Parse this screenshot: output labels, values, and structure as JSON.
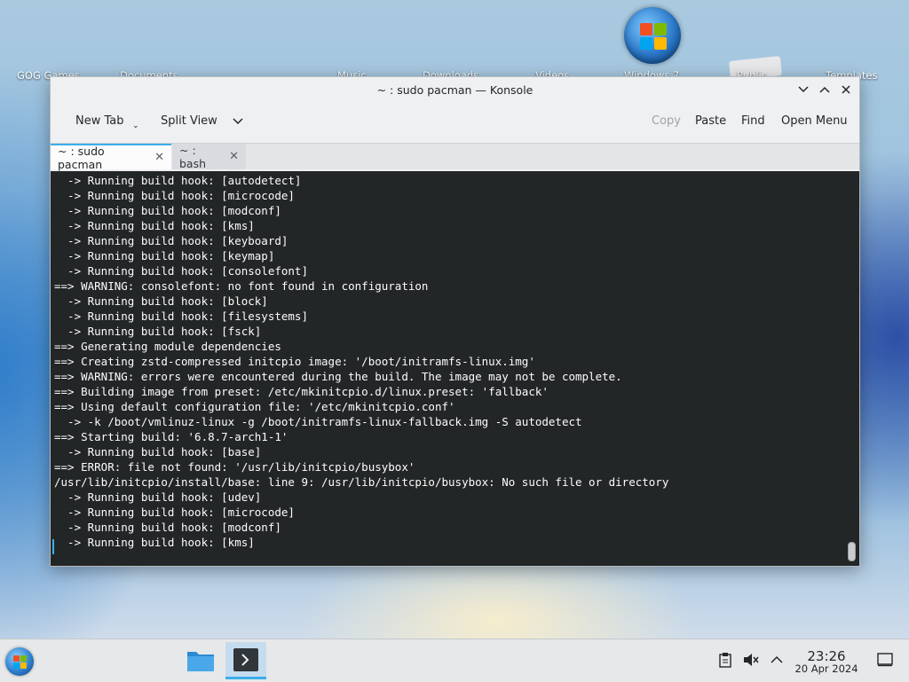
{
  "desktop": {
    "icons": [
      {
        "label": "GOG Games"
      },
      {
        "label": "Documents"
      },
      {
        "label": "Music"
      },
      {
        "label": "Downloads"
      },
      {
        "label": "Videos"
      },
      {
        "label": "Windows 7"
      },
      {
        "label": "Public"
      },
      {
        "label": "Templates"
      }
    ]
  },
  "window": {
    "title": "~ : sudo pacman — Konsole",
    "toolbar": {
      "new_tab": "New Tab",
      "split_view": "Split View",
      "copy": "Copy",
      "paste": "Paste",
      "find": "Find",
      "open_menu": "Open Menu"
    },
    "tabs": [
      {
        "label": "~ : sudo pacman",
        "active": true
      },
      {
        "label": "~ : bash",
        "active": false
      }
    ],
    "terminal_lines": [
      "  -> Running build hook: [autodetect]",
      "  -> Running build hook: [microcode]",
      "  -> Running build hook: [modconf]",
      "  -> Running build hook: [kms]",
      "  -> Running build hook: [keyboard]",
      "  -> Running build hook: [keymap]",
      "  -> Running build hook: [consolefont]",
      "==> WARNING: consolefont: no font found in configuration",
      "  -> Running build hook: [block]",
      "  -> Running build hook: [filesystems]",
      "  -> Running build hook: [fsck]",
      "==> Generating module dependencies",
      "==> Creating zstd-compressed initcpio image: '/boot/initramfs-linux.img'",
      "==> WARNING: errors were encountered during the build. The image may not be complete.",
      "==> Building image from preset: /etc/mkinitcpio.d/linux.preset: 'fallback'",
      "==> Using default configuration file: '/etc/mkinitcpio.conf'",
      "  -> -k /boot/vmlinuz-linux -g /boot/initramfs-linux-fallback.img -S autodetect",
      "==> Starting build: '6.8.7-arch1-1'",
      "  -> Running build hook: [base]",
      "==> ERROR: file not found: '/usr/lib/initcpio/busybox'",
      "/usr/lib/initcpio/install/base: line 9: /usr/lib/initcpio/busybox: No such file or directory",
      "  -> Running build hook: [udev]",
      "  -> Running build hook: [microcode]",
      "  -> Running build hook: [modconf]",
      "  -> Running build hook: [kms]"
    ]
  },
  "taskbar": {
    "clock_time": "23:26",
    "clock_date": "20 Apr 2024",
    "tray_icons": [
      "clipboard-icon",
      "volume-muted-icon",
      "chevron-up-icon"
    ]
  },
  "colors": {
    "accent": "#3daee9",
    "terminal_bg": "#232627",
    "terminal_fg": "#fcfcfc"
  }
}
